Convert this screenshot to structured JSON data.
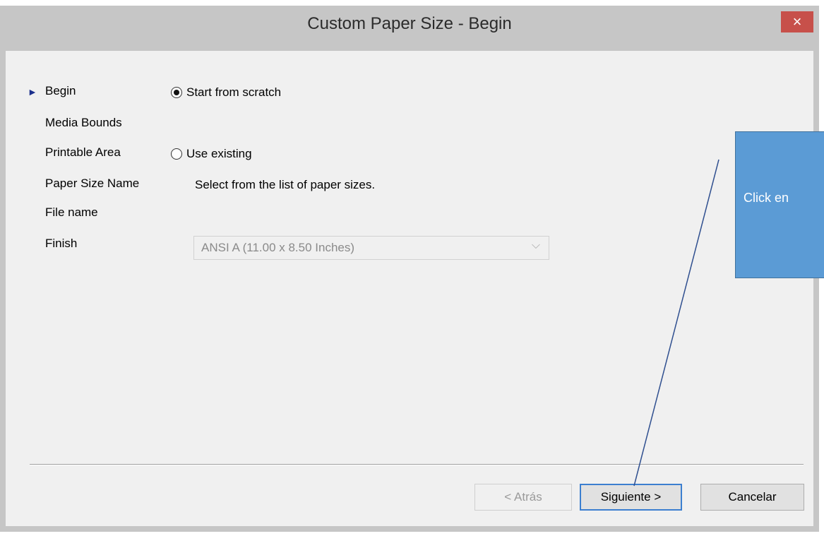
{
  "window": {
    "title": "Custom Paper Size - Begin",
    "close_label": "×"
  },
  "nav": {
    "current_marker": "►",
    "items": [
      {
        "label": "Begin"
      },
      {
        "label": "Media Bounds"
      },
      {
        "label": "Printable Area"
      },
      {
        "label": "Paper Size Name"
      },
      {
        "label": "File name"
      },
      {
        "label": "Finish"
      }
    ]
  },
  "options": {
    "start_from_scratch": {
      "label": "Start from scratch",
      "selected": true
    },
    "use_existing": {
      "label": "Use existing",
      "selected": false
    },
    "hint": "Select from the list of paper sizes.",
    "paper_size_select": {
      "value": "ANSI A (11.00 x 8.50 Inches)",
      "enabled": false
    }
  },
  "buttons": {
    "back": "< Atrás",
    "next": "Siguiente >",
    "cancel": "Cancelar"
  },
  "annotation": {
    "callout_text": "Click en",
    "colors": {
      "fill": "#5b9bd5",
      "border": "#41719c",
      "text": "#ffffff",
      "line": "#2f4f8f"
    }
  },
  "icons": {
    "nav_marker": "play-triangle-icon",
    "dropdown": "chevron-down-icon",
    "close": "close-icon"
  }
}
